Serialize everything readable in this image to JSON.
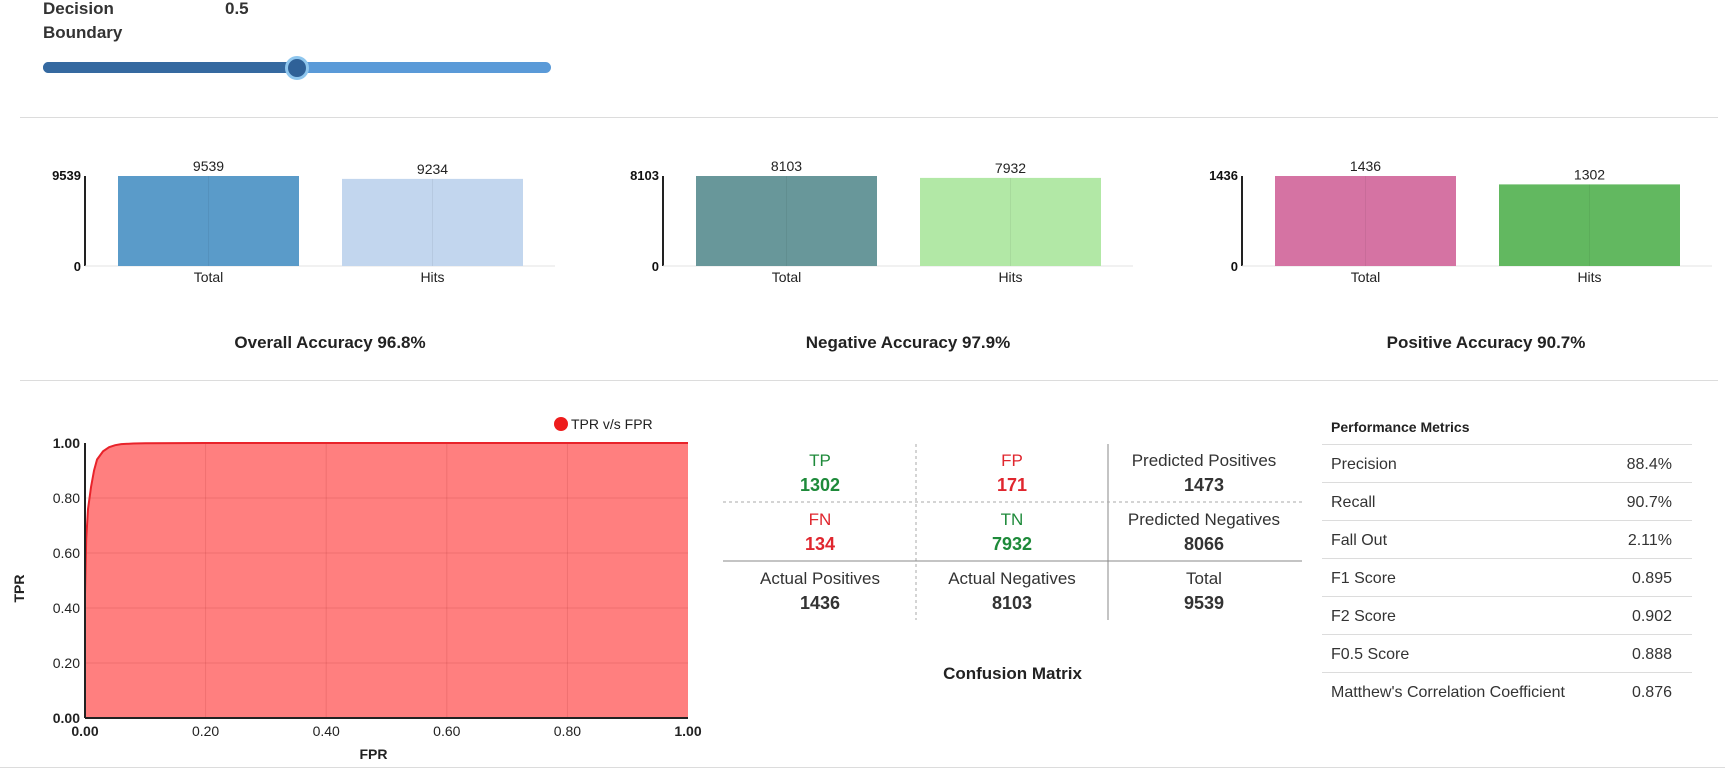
{
  "slider": {
    "label": "Decision Boundary",
    "value_text": "0.5",
    "value": 0.5
  },
  "bar_charts_text": {
    "overall_accuracy": "Overall Accuracy 96.8%",
    "negative_accuracy": "Negative Accuracy 97.9%",
    "positive_accuracy": "Positive Accuracy 90.7%"
  },
  "chart_data": [
    {
      "type": "bar",
      "categories": [
        "Total",
        "Hits"
      ],
      "values": [
        9539,
        9234
      ],
      "ylim": [
        0,
        9539
      ],
      "yticks": [
        "9539",
        "0"
      ],
      "colors": [
        "#5a9bc9",
        "#c2d6ee"
      ],
      "title": "Overall Accuracy 96.8%",
      "grid": false
    },
    {
      "type": "bar",
      "categories": [
        "Total",
        "Hits"
      ],
      "values": [
        8103,
        7932
      ],
      "ylim": [
        0,
        8103
      ],
      "yticks": [
        "8103",
        "0"
      ],
      "colors": [
        "#68979a",
        "#b2e8a6"
      ],
      "title": "Negative Accuracy 97.9%",
      "grid": false
    },
    {
      "type": "bar",
      "categories": [
        "Total",
        "Hits"
      ],
      "values": [
        1436,
        1302
      ],
      "ylim": [
        0,
        1436
      ],
      "yticks": [
        "1436",
        "0"
      ],
      "colors": [
        "#d573a3",
        "#62b860"
      ],
      "title": "Positive Accuracy 90.7%",
      "grid": false
    },
    {
      "type": "area",
      "legend": "TPR v/s FPR",
      "legend_position": "top-right",
      "xlabel": "FPR",
      "ylabel": "TPR",
      "xlim": [
        0,
        1
      ],
      "ylim": [
        0,
        1
      ],
      "xticks": [
        "0.00",
        "0.20",
        "0.40",
        "0.60",
        "0.80",
        "1.00"
      ],
      "yticks": [
        "0.00",
        "0.20",
        "0.40",
        "0.60",
        "0.80",
        "1.00"
      ],
      "color": "#ff7f7f",
      "line_color": "#e8232a",
      "grid": true,
      "x": [
        0,
        0.0,
        0.002,
        0.005,
        0.01,
        0.015,
        0.02,
        0.03,
        0.04,
        0.05,
        0.06,
        0.08,
        0.1,
        0.2,
        0.4,
        0.6,
        0.8,
        1.0
      ],
      "y": [
        0,
        0.45,
        0.65,
        0.76,
        0.84,
        0.9,
        0.94,
        0.97,
        0.985,
        0.992,
        0.996,
        0.998,
        0.999,
        1.0,
        1.0,
        1.0,
        1.0,
        1.0
      ]
    }
  ],
  "confusion_matrix": {
    "title": "Confusion Matrix",
    "tp_label": "TP",
    "tp_value": "1302",
    "fp_label": "FP",
    "fp_value": "171",
    "pred_pos_label": "Predicted Positives",
    "pred_pos_value": "1473",
    "fn_label": "FN",
    "fn_value": "134",
    "tn_label": "TN",
    "tn_value": "7932",
    "pred_neg_label": "Predicted Negatives",
    "pred_neg_value": "8066",
    "act_pos_label": "Actual Positives",
    "act_pos_value": "1436",
    "act_neg_label": "Actual Negatives",
    "act_neg_value": "8103",
    "total_label": "Total",
    "total_value": "9539"
  },
  "metrics": {
    "title": "Performance Metrics",
    "rows": [
      {
        "name": "Precision",
        "value": "88.4%"
      },
      {
        "name": "Recall",
        "value": "90.7%"
      },
      {
        "name": "Fall Out",
        "value": "2.11%"
      },
      {
        "name": "F1 Score",
        "value": "0.895"
      },
      {
        "name": "F2 Score",
        "value": "0.902"
      },
      {
        "name": "F0.5 Score",
        "value": "0.888"
      },
      {
        "name": "Matthew's Correlation Coefficient",
        "value": "0.876"
      }
    ]
  }
}
